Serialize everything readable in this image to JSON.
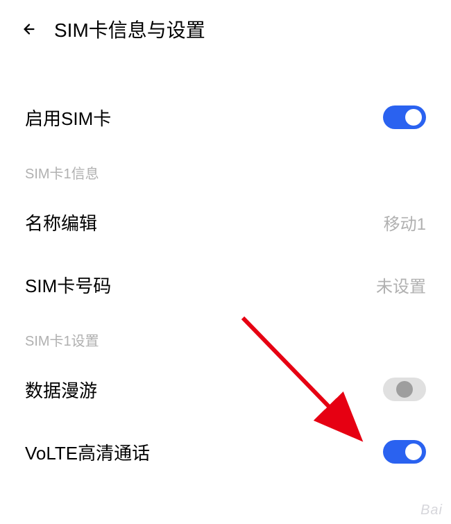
{
  "header": {
    "title": "SIM卡信息与设置"
  },
  "rows": {
    "enable_sim": {
      "label": "启用SIM卡",
      "state": "on"
    }
  },
  "sections": {
    "sim_info_header": "SIM卡1信息",
    "sim_settings_header": "SIM卡1设置"
  },
  "name_edit": {
    "label": "名称编辑",
    "value": "移动1"
  },
  "sim_number": {
    "label": "SIM卡号码",
    "value": "未设置"
  },
  "data_roaming": {
    "label": "数据漫游",
    "state": "off"
  },
  "volte": {
    "label": "VoLTE高清通话",
    "state": "on"
  },
  "partial": {
    "label": "—    "
  },
  "watermark": "Bai"
}
